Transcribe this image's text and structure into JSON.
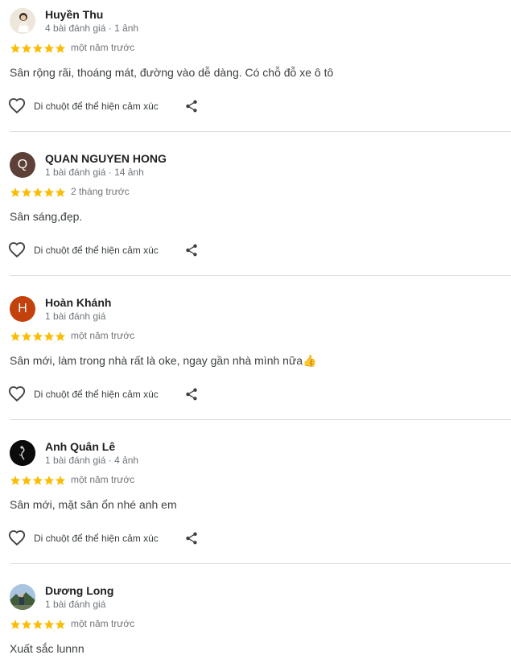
{
  "colors": {
    "star": "#fbbc04",
    "text_secondary": "#70757a",
    "divider": "#dadce0"
  },
  "review_actions": {
    "react_label": "Di chuột để thể hiện cảm xúc"
  },
  "reviews": [
    {
      "name": "Huyền Thu",
      "meta": "4 bài đánh giá · 1 ảnh",
      "rating": 5,
      "time": "một năm trước",
      "text": "Sân rộng rãi, thoáng mát, đường vào dễ dàng. Có chỗ đỗ xe ô tô",
      "avatar_icon": "photo-avatar"
    },
    {
      "name": "QUAN NGUYEN HONG",
      "meta": "1 bài đánh giá · 14 ảnh",
      "rating": 5,
      "time": "2 tháng trước",
      "text": "Sân sáng,đẹp.",
      "avatar_letter": "Q",
      "avatar_color": "#5d4037"
    },
    {
      "name": "Hoàn Khánh",
      "meta": "1 bài đánh giá",
      "rating": 5,
      "time": "một năm trước",
      "text": "Sân mới, làm trong nhà rất là oke, ngay gần nhà mình nữa👍",
      "avatar_letter": "H",
      "avatar_color": "#c2410c"
    },
    {
      "name": "Anh Quân Lê",
      "meta": "1 bài đánh giá · 4 ảnh",
      "rating": 5,
      "time": "một năm trước",
      "text": "Sân mới, mặt sân ổn nhé anh em",
      "avatar_icon": "photo-avatar-dark"
    },
    {
      "name": "Dương Long",
      "meta": "1 bài đánh giá",
      "rating": 5,
      "time": "một năm trước",
      "text": "Xuất sắc lunnn",
      "avatar_icon": "photo-avatar-landscape"
    }
  ]
}
